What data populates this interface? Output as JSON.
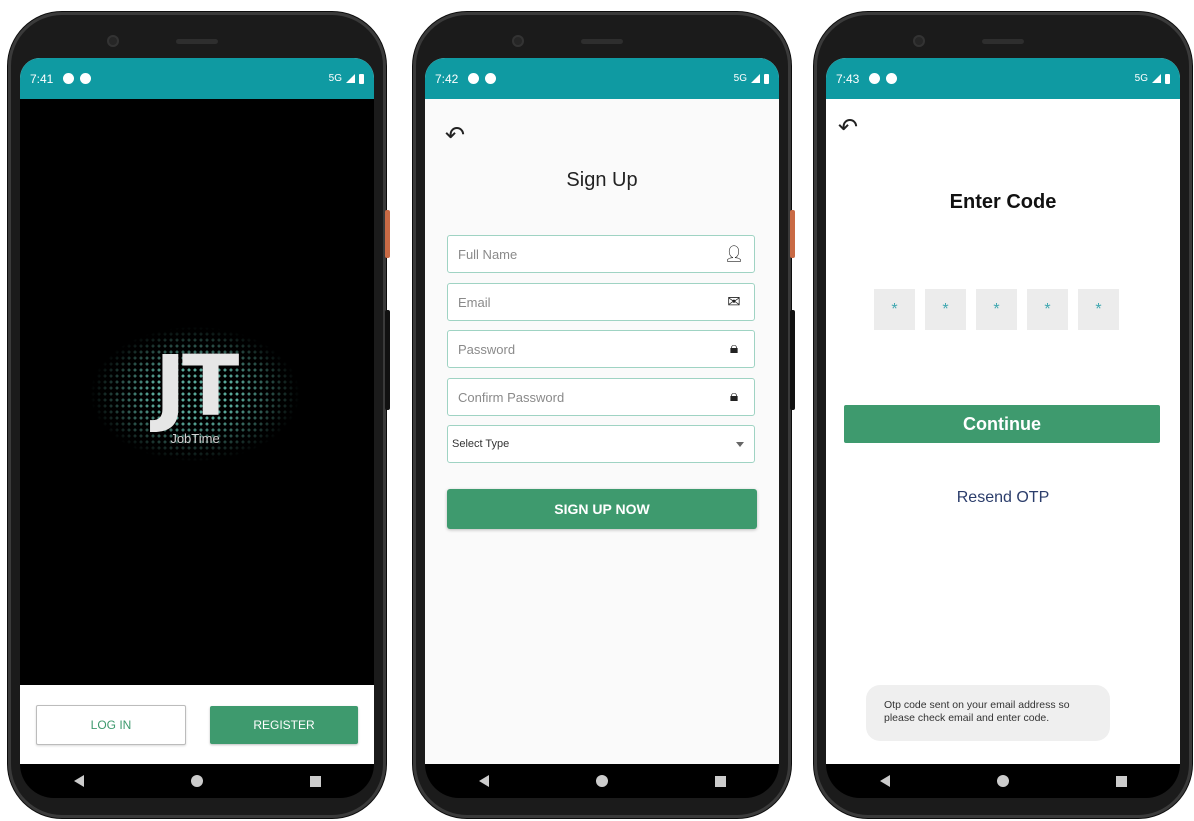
{
  "phones": [
    {
      "status": {
        "time": "7:41",
        "network": "5G"
      },
      "logo": {
        "mark": "JT",
        "subtitle": "JobTime"
      },
      "actions": {
        "login_label": "LOG IN",
        "register_label": "REGISTER"
      }
    },
    {
      "status": {
        "time": "7:42",
        "network": "5G"
      },
      "title": "Sign Up",
      "fields": {
        "full_name": "Full Name",
        "email": "Email",
        "password": "Password",
        "confirm_password": "Confirm Password",
        "select_type": "Select Type"
      },
      "submit_label": "SIGN UP NOW"
    },
    {
      "status": {
        "time": "7:43",
        "network": "5G"
      },
      "title": "Enter Code",
      "otp_digits": [
        "*",
        "*",
        "*",
        "*",
        "*"
      ],
      "continue_label": "Continue",
      "resend_label": "Resend OTP",
      "toast": "Otp code sent on your email address so please check email and enter code."
    }
  ],
  "colors": {
    "status_bar": "#0f9aa2",
    "accent_green": "#3e9a6e",
    "link_navy": "#2b3d6b"
  }
}
